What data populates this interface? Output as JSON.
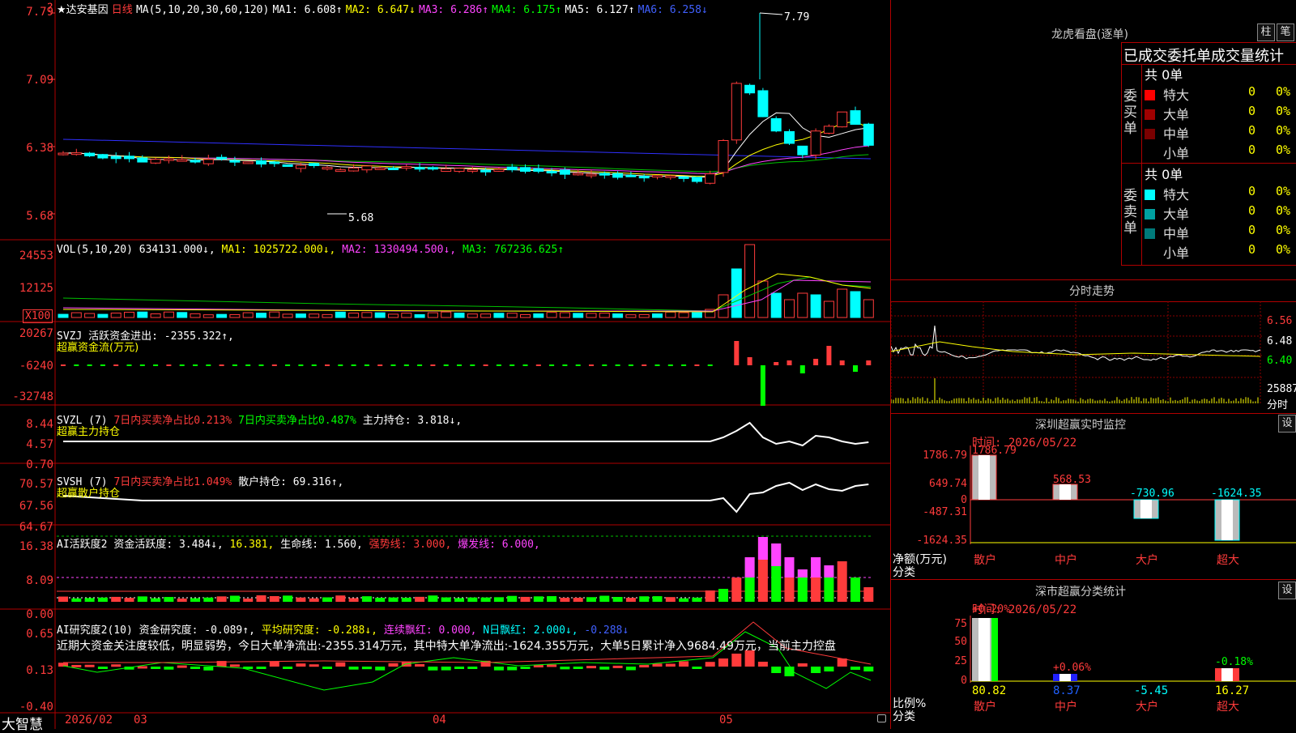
{
  "header": {
    "stock_name": "★达安基因",
    "period": "日线",
    "ma_param": "MA(5,10,20,30,60,120)",
    "ma1": "MA1: 6.608↑",
    "ma2": "MA2: 6.647↓",
    "ma3": "MA3: 6.286↑",
    "ma4": "MA4: 6.175↑",
    "ma5": "MA5: 6.127↑",
    "ma6": "MA6: 6.258↓",
    "high_mark": "7.79",
    "low_mark": "5.68"
  },
  "price_axis": [
    "7.79",
    "7.09",
    "6.38",
    "5.68"
  ],
  "vol": {
    "title": "VOL(5,10,20)",
    "vol_value": "634131.000↓,",
    "ma1": "MA1: 1025722.000↓,",
    "ma2": "MA2: 1330494.500↓,",
    "ma3": "MA3: 767236.625↑",
    "axis": [
      "24553",
      "12125",
      "X100"
    ]
  },
  "svzj": {
    "title": "SVZJ",
    "text": "活跃资金进出: -2355.322↑,",
    "sub": "超赢资金流(万元)",
    "axis": [
      "20267",
      "-6240",
      "-32748"
    ]
  },
  "svzl": {
    "title": "SVZL (7)",
    "t1": "7日内买卖净占比0.213%",
    "t2": "7日内买卖净占比0.487%",
    "t3": "主力持仓: 3.818↓,",
    "sub": "超赢主力持仓",
    "axis": [
      "8.44",
      "4.57",
      "0.70"
    ]
  },
  "svsh": {
    "title": "SVSH (7)",
    "t1": "7日内买卖净占比1.049%",
    "t2": "散户持仓: 69.316↑,",
    "sub": "超赢散户持仓",
    "axis": [
      "70.57",
      "67.56",
      "64.67"
    ]
  },
  "ai1": {
    "title": "AI活跃度2",
    "t1": "资金活跃度: 3.484↓,",
    "t2": "16.381,",
    "t3": "生命线: 1.560,",
    "t4": "强势线: 3.000,",
    "t5": "爆发线: 6.000,",
    "axis": [
      "16.38",
      "8.09",
      "0.00"
    ]
  },
  "ai2": {
    "title": "AI研究度2(10)",
    "t1": "资金研究度: -0.089↑,",
    "t2": "平均研究度: -0.288↓,",
    "t3": "连续飘红: 0.000,",
    "t4": "N日飘红: 2.000↓,",
    "t5": "-0.288↓",
    "note": "近期大资金关注度较低，明显弱势，今日大单净流出:-2355.314万元，其中特大单净流出:-1624.355万元，大单5日累计净入9684.49万元，当前主力控盘",
    "axis": [
      "0.65",
      "0.13",
      "-0.40"
    ]
  },
  "bottom_axis": {
    "brand": "大智慧",
    "dates": [
      "2026/02",
      "03",
      "04",
      "05"
    ]
  },
  "right_panel": {
    "lhb_title": "龙虎看盘(逐单)",
    "btn_bar": "柱",
    "btn_pen": "笔",
    "tab_title": "已成交委托单成交量统计",
    "buy_label": "委买单",
    "sell_label": "委卖单",
    "buy_total": "共 0单",
    "sell_total": "共 0单",
    "rows": [
      {
        "name": "特大",
        "qty": "0",
        "pct": "0%"
      },
      {
        "name": "大单",
        "qty": "0",
        "pct": "0%"
      },
      {
        "name": "中单",
        "qty": "0",
        "pct": "0%"
      },
      {
        "name": "小单",
        "qty": "0",
        "pct": "0%"
      }
    ],
    "buy_colors": [
      "#ff0000",
      "#a00000",
      "#7a0000",
      "#000000"
    ],
    "sell_colors": [
      "#00ffff",
      "#00a0a0",
      "#007a7a",
      "#000000"
    ],
    "intraday_title": "分时走势",
    "intraday_axis": [
      "6.56",
      "6.48",
      "6.40",
      "25887",
      "分时"
    ],
    "sz_title": "深圳超赢实时监控",
    "sz_btn": "设",
    "sz_time": "时间: 2026/05/22",
    "sz_axis": [
      "1786.79",
      "649.74",
      "0",
      "-487.31",
      "-1624.35"
    ],
    "sz_vals": [
      "1786.79",
      "568.53",
      "-730.96",
      "-1624.35"
    ],
    "sz_cats": [
      "散户",
      "中户",
      "大户",
      "超大"
    ],
    "sz_ylabel": "净额(万元)",
    "sz_xlabel": "分类",
    "cls_title": "深市超赢分类统计",
    "cls_btn": "设",
    "cls_time": "时间: 2026/05/22",
    "cls_axis": [
      "75",
      "50",
      "25",
      "0"
    ],
    "cls_top": [
      "+0.20%",
      "+0.06%",
      "-0.18%"
    ],
    "cls_vals": [
      "80.82",
      "8.37",
      "-5.45",
      "16.27"
    ],
    "cls_cats": [
      "散户",
      "中户",
      "大户",
      "超大"
    ],
    "cls_ylabel": "比例%",
    "cls_xlabel": "分类"
  }
}
